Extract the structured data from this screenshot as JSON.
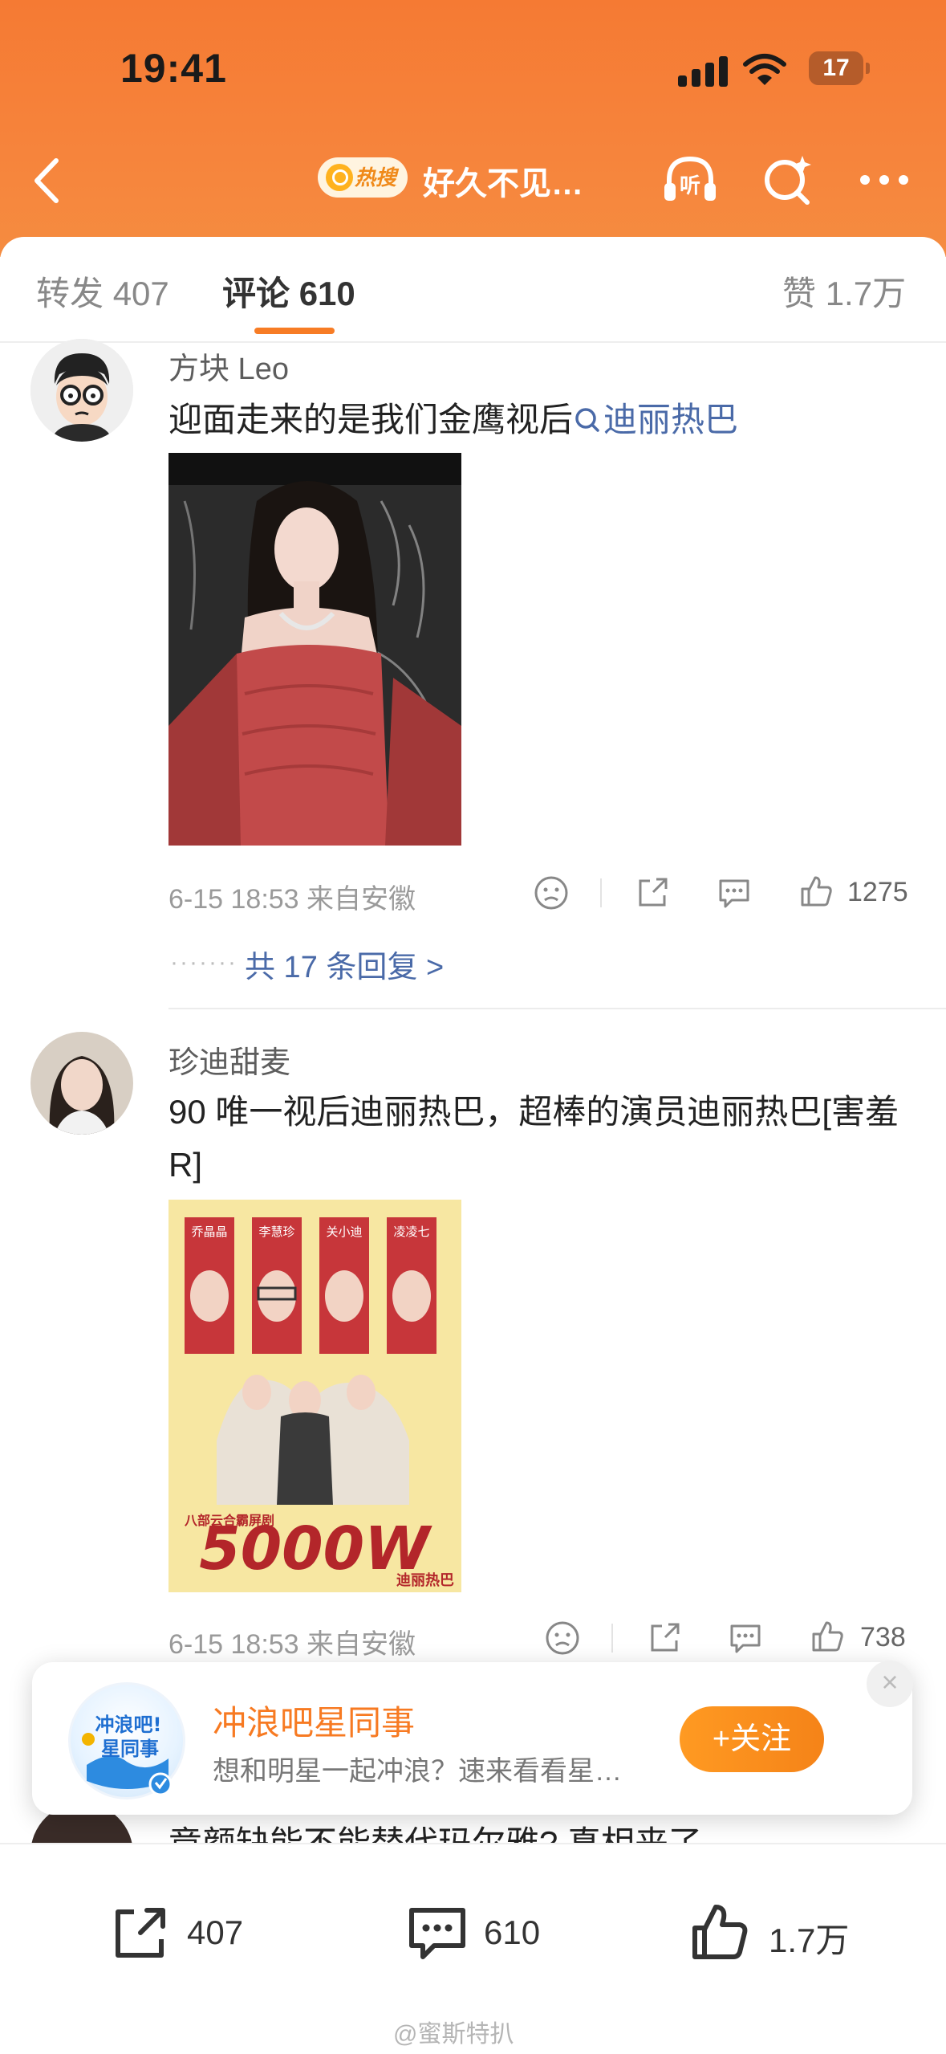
{
  "status_bar": {
    "time": "19:41",
    "battery": "17"
  },
  "nav": {
    "hot_badge": "热搜",
    "title": "好久不见…"
  },
  "tabs": [
    {
      "label": "转发",
      "count": "407"
    },
    {
      "label": "评论",
      "count": "610"
    },
    {
      "label": "赞",
      "count": "1.7万"
    }
  ],
  "comments": [
    {
      "user": "方块 Leo",
      "text": "迎面走来的是我们金鹰视后",
      "topic": "迪丽热巴",
      "time": "6-15 18:53",
      "location": "来自安徽",
      "likes": "1275",
      "replies_link": "共 17 条回复 >"
    },
    {
      "user": "珍迪甜麦",
      "text": "90 唯一视后迪丽热巴，超棒的演员迪丽热巴[害羞 R]",
      "time": "6-15 18:53",
      "location": "来自安徽",
      "likes": "738",
      "poster_names": [
        "乔晶晶",
        "李慧珍",
        "关小迪",
        "凌凌七"
      ],
      "poster_caption": "八部云合霸屏剧",
      "poster_big": "5000W",
      "poster_brand": "迪丽热巴"
    }
  ],
  "partial_next": {
    "text": "竟颜缺能不能替代玛尔雅? 真相来了"
  },
  "popup": {
    "avatar_text_1": "冲浪吧!",
    "avatar_text_2": "星同事",
    "title": "冲浪吧星同事",
    "description": "想和明星一起冲浪？速来看看星…",
    "follow_label": "+关注",
    "close": "×"
  },
  "bottom_bar": {
    "repost_count": "407",
    "comment_count": "610",
    "like_count": "1.7万"
  },
  "watermark": "@蜜斯特扒",
  "colors": {
    "header": "#f57a33",
    "accent": "#f77c25",
    "link": "#4a6aa8"
  }
}
